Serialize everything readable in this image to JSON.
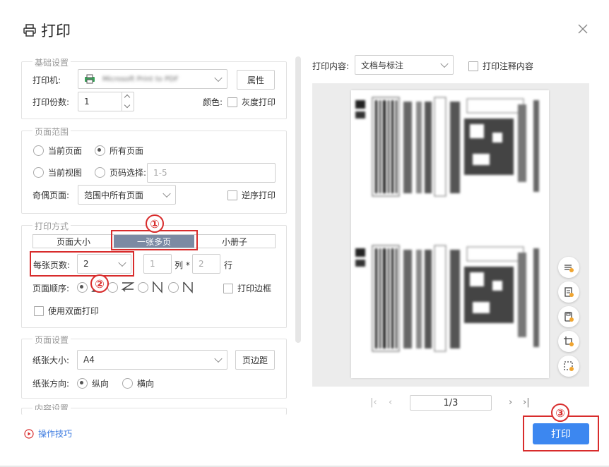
{
  "dialog": {
    "title": "打印"
  },
  "basic": {
    "legend": "基础设置",
    "printer_label": "打印机:",
    "printer_value": "Microsoft Print to PDF",
    "properties_button": "属性",
    "copies_label": "打印份数:",
    "copies_value": "1",
    "color_label": "颜色:",
    "grayscale_label": "灰度打印"
  },
  "range": {
    "legend": "页面范围",
    "current_page": "当前页面",
    "all_pages": "所有页面",
    "current_view": "当前视图",
    "page_select": "页码选择:",
    "page_select_placeholder": "1-5",
    "odd_even_label": "奇偶页面:",
    "odd_even_value": "范围中所有页面",
    "reverse_label": "逆序打印"
  },
  "mode": {
    "legend": "打印方式",
    "tabs": [
      "页面大小",
      "一张多页",
      "小册子"
    ],
    "per_sheet_label": "每张页数:",
    "per_sheet_value": "2",
    "cols_value": "1",
    "cols_label": "列 *",
    "rows_value": "2",
    "rows_label": "行",
    "order_label": "页面顺序:",
    "print_border_label": "打印边框",
    "duplex_label": "使用双面打印"
  },
  "pagesetup": {
    "legend": "页面设置",
    "paper_label": "纸张大小:",
    "paper_value": "A4",
    "margins_button": "页边距",
    "orient_label": "纸张方向:",
    "portrait": "纵向",
    "landscape": "横向"
  },
  "content_settings": {
    "legend": "内容设置"
  },
  "right": {
    "content_label": "打印内容:",
    "content_value": "文档与标注",
    "annot_label": "打印注释内容"
  },
  "pager": {
    "value": "1/3"
  },
  "footer": {
    "tips": "操作技巧",
    "print_button": "打印"
  },
  "badges": [
    "①",
    "②",
    "③"
  ],
  "colors": {
    "accent": "#3c87f0",
    "highlight": "#d82c2c",
    "active_tab": "#7c8aa3"
  }
}
